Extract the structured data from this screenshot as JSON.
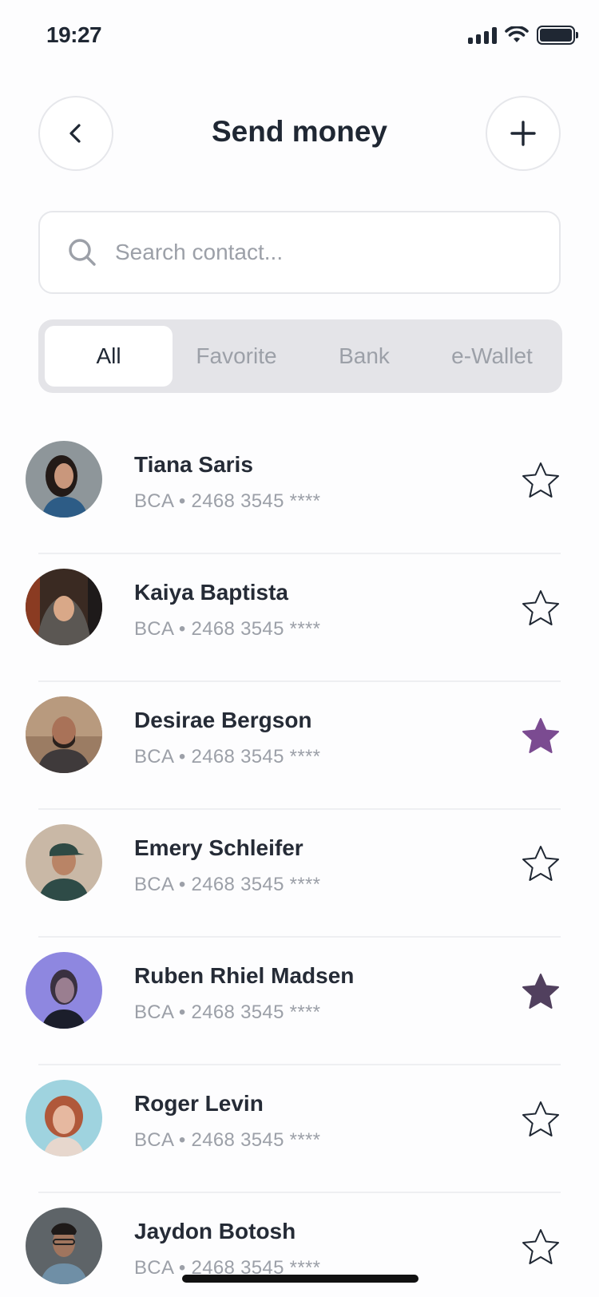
{
  "status_bar": {
    "time": "19:27"
  },
  "header": {
    "title": "Send money"
  },
  "search": {
    "placeholder": "Search contact..."
  },
  "tabs": [
    {
      "label": "All",
      "active": true
    },
    {
      "label": "Favorite",
      "active": false
    },
    {
      "label": "Bank",
      "active": false
    },
    {
      "label": "e-Wallet",
      "active": false
    }
  ],
  "contacts": [
    {
      "name": "Tiana Saris",
      "account": "BCA • 2468 3545 ****",
      "favorite": false
    },
    {
      "name": "Kaiya Baptista",
      "account": "BCA • 2468 3545 ****",
      "favorite": false
    },
    {
      "name": "Desirae Bergson",
      "account": "BCA • 2468 3545 ****",
      "favorite": true
    },
    {
      "name": "Emery Schleifer",
      "account": "BCA • 2468 3545 ****",
      "favorite": false
    },
    {
      "name": "Ruben Rhiel Madsen",
      "account": "BCA • 2468 3545 ****",
      "favorite": true
    },
    {
      "name": "Roger Levin",
      "account": "BCA • 2468 3545 ****",
      "favorite": false
    },
    {
      "name": "Jaydon Botosh",
      "account": "BCA • 2468 3545 ****",
      "favorite": false
    }
  ],
  "colors": {
    "text_primary": "#1F2733",
    "text_muted": "#9CA0A8",
    "star_favorite_1": "#7B4B91",
    "star_favorite_2": "#51405E",
    "star_outline": "#1F2733"
  }
}
